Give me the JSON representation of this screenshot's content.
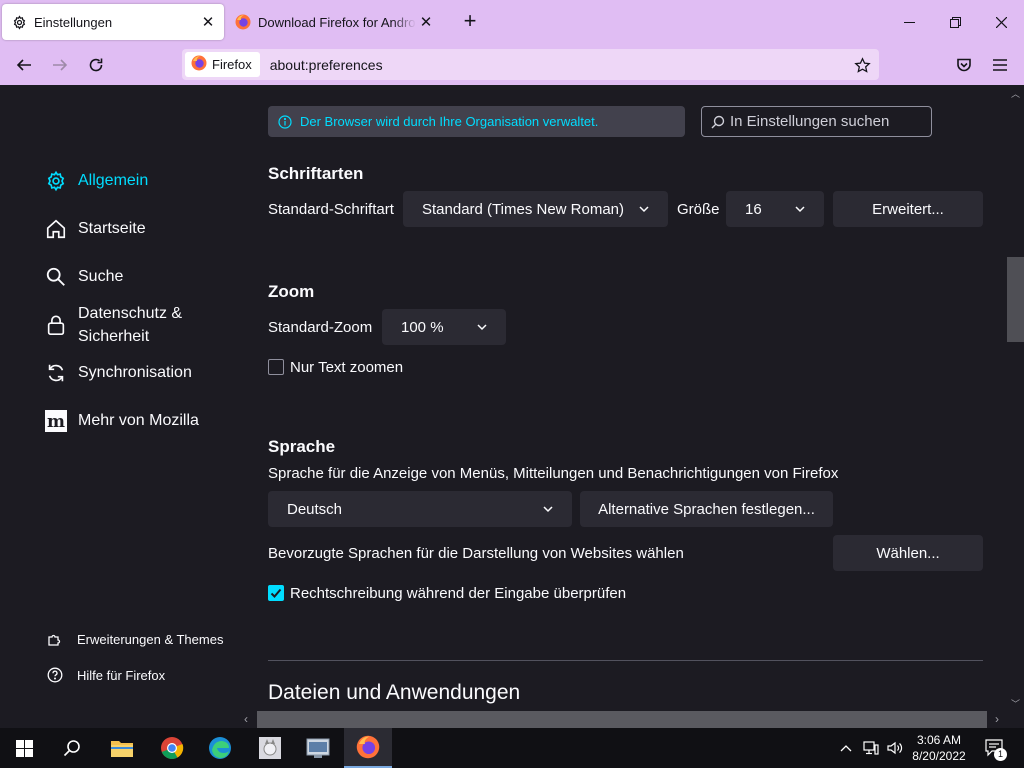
{
  "browser": {
    "tabs": [
      {
        "label": "Einstellungen",
        "icon": "gear-icon",
        "active": true
      },
      {
        "label": "Download Firefox for Android a",
        "icon": "firefox-icon",
        "active": false
      }
    ],
    "new_tab": "+",
    "window_controls": {
      "minimize": "—",
      "maximize": "❐",
      "close": "✕"
    },
    "identity_label": "Firefox",
    "url": "about:preferences"
  },
  "sidebar": {
    "categories": [
      {
        "label": "Allgemein",
        "icon": "gear-icon",
        "selected": true
      },
      {
        "label": "Startseite",
        "icon": "home-icon"
      },
      {
        "label": "Suche",
        "icon": "search-icon"
      },
      {
        "label": "Datenschutz &",
        "label2": "Sicherheit",
        "icon": "lock-icon"
      },
      {
        "label": "Synchronisation",
        "icon": "sync-icon"
      },
      {
        "label": "Mehr von Mozilla",
        "icon": "mozilla-icon"
      }
    ],
    "footer": [
      {
        "label": "Erweiterungen & Themes",
        "icon": "puzzle-icon"
      },
      {
        "label": "Hilfe für Firefox",
        "icon": "help-icon"
      }
    ]
  },
  "main": {
    "policy_notice": "Der Browser wird durch Ihre Organisation verwaltet.",
    "search_placeholder": "In Einstellungen suchen",
    "fonts": {
      "heading": "Schriftarten",
      "default_font_label": "Standard-Schriftart",
      "default_font_value": "Standard (Times New Roman)",
      "size_label": "Größe",
      "size_value": "16",
      "advanced_button": "Erweitert..."
    },
    "zoom": {
      "heading": "Zoom",
      "default_zoom_label": "Standard-Zoom",
      "default_zoom_value": "100 %",
      "text_only_label": "Nur Text zoomen",
      "text_only_checked": false
    },
    "language": {
      "heading": "Sprache",
      "description": "Sprache für die Anzeige von Menüs, Mitteilungen und Benachrichtigungen von Firefox",
      "language_value": "Deutsch",
      "alternative_button": "Alternative Sprachen festlegen...",
      "websites_label": "Bevorzugte Sprachen für die Darstellung von Websites wählen",
      "choose_button": "Wählen...",
      "spellcheck_label": "Rechtschreibung während der Eingabe überprüfen",
      "spellcheck_checked": true
    },
    "files_heading": "Dateien und Anwendungen"
  },
  "taskbar": {
    "clock_time": "3:06 AM",
    "clock_date": "8/20/2022",
    "notification_count": "1"
  },
  "colors": {
    "accent": "#00ddff",
    "background": "#1c1b22",
    "control": "#2b2a33",
    "tabbar": "#e0bdf3"
  }
}
